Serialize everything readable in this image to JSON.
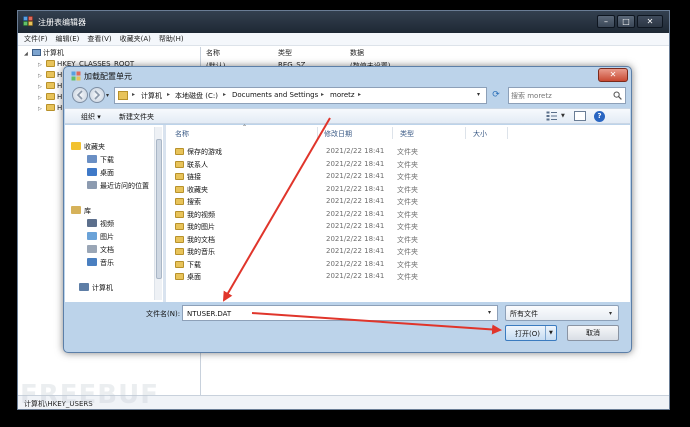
{
  "regedit": {
    "title": "注册表编辑器",
    "menu": [
      "文件(F)",
      "编辑(E)",
      "查看(V)",
      "收藏夹(A)",
      "帮助(H)"
    ],
    "tree": [
      {
        "label": "计算机",
        "expander": "◢"
      },
      {
        "label": "HKEY_CLASSES_ROOT",
        "expander": "▷"
      },
      {
        "label": "H",
        "expander": "▷"
      },
      {
        "label": "H",
        "expander": "▷"
      },
      {
        "label": "H",
        "expander": "▷"
      },
      {
        "label": "H",
        "expander": "▷"
      }
    ],
    "columns": [
      "名称",
      "类型",
      "数据"
    ],
    "first_row": {
      "name": "(默认)",
      "type": "REG_SZ",
      "data": "(数值未设置)"
    },
    "status": "计算机\\HKEY_USERS",
    "caption": {
      "minimize": "–",
      "maximize": "□",
      "close": "✕"
    }
  },
  "dialog": {
    "title": "加载配置单元",
    "close_label": "✕",
    "address": {
      "crumbs": [
        "计算机",
        "本地磁盘 (C:)",
        "Documents and Settings",
        "moretz"
      ],
      "separator": "▸"
    },
    "search_placeholder": "搜索 moretz",
    "refresh_label": "⟳",
    "toolbar": {
      "organize": "组织 ▾",
      "new_folder": "新建文件夹",
      "views_dd": "▼",
      "help": "?"
    },
    "nav": [
      {
        "label": "收藏夹",
        "icon": "star-icon",
        "color": "#f2c230",
        "indent": 0
      },
      {
        "label": "下载",
        "icon": "downloads-icon",
        "color": "#6a8fc4",
        "indent": 1
      },
      {
        "label": "桌面",
        "icon": "desktop-icon",
        "color": "#3f79c8",
        "indent": 1
      },
      {
        "label": "最近访问的位置",
        "icon": "recent-icon",
        "color": "#8c9bb0",
        "indent": 1
      },
      {
        "label": "库",
        "icon": "library-icon",
        "color": "#d6b25a",
        "indent": 0
      },
      {
        "label": "视频",
        "icon": "video-icon",
        "color": "#5c6f8c",
        "indent": 1
      },
      {
        "label": "图片",
        "icon": "pictures-icon",
        "color": "#6aa2d8",
        "indent": 1
      },
      {
        "label": "文档",
        "icon": "documents-icon",
        "color": "#9aa6b6",
        "indent": 1
      },
      {
        "label": "音乐",
        "icon": "music-icon",
        "color": "#4a7fc0",
        "indent": 1
      },
      {
        "label": "计算机",
        "icon": "computer-icon",
        "color": "#5e7ea6",
        "indent": 0
      }
    ],
    "columns": {
      "name": "名称",
      "date": "修改日期",
      "type": "类型",
      "size": "大小"
    },
    "files": [
      {
        "name": "保存的游戏",
        "date": "2021/2/22 18:41",
        "type": "文件夹"
      },
      {
        "name": "联系人",
        "date": "2021/2/22 18:41",
        "type": "文件夹"
      },
      {
        "name": "链接",
        "date": "2021/2/22 18:41",
        "type": "文件夹"
      },
      {
        "name": "收藏夹",
        "date": "2021/2/22 18:41",
        "type": "文件夹"
      },
      {
        "name": "搜索",
        "date": "2021/2/22 18:41",
        "type": "文件夹"
      },
      {
        "name": "我的视频",
        "date": "2021/2/22 18:41",
        "type": "文件夹"
      },
      {
        "name": "我的图片",
        "date": "2021/2/22 18:41",
        "type": "文件夹"
      },
      {
        "name": "我的文档",
        "date": "2021/2/22 18:41",
        "type": "文件夹"
      },
      {
        "name": "我的音乐",
        "date": "2021/2/22 18:41",
        "type": "文件夹"
      },
      {
        "name": "下载",
        "date": "2021/2/22 18:41",
        "type": "文件夹"
      },
      {
        "name": "桌面",
        "date": "2021/2/22 18:41",
        "type": "文件夹"
      }
    ],
    "filename_label": "文件名(N):",
    "filename_value": "NTUSER.DAT",
    "filter_value": "所有文件",
    "open_label": "打开(O)",
    "cancel_label": "取消"
  },
  "colors": {
    "annotation_arrow": "#e0352b",
    "dialog_frame": "#bcd3ea",
    "title_dark": "#1e2834"
  },
  "watermark": "FREEBUF"
}
